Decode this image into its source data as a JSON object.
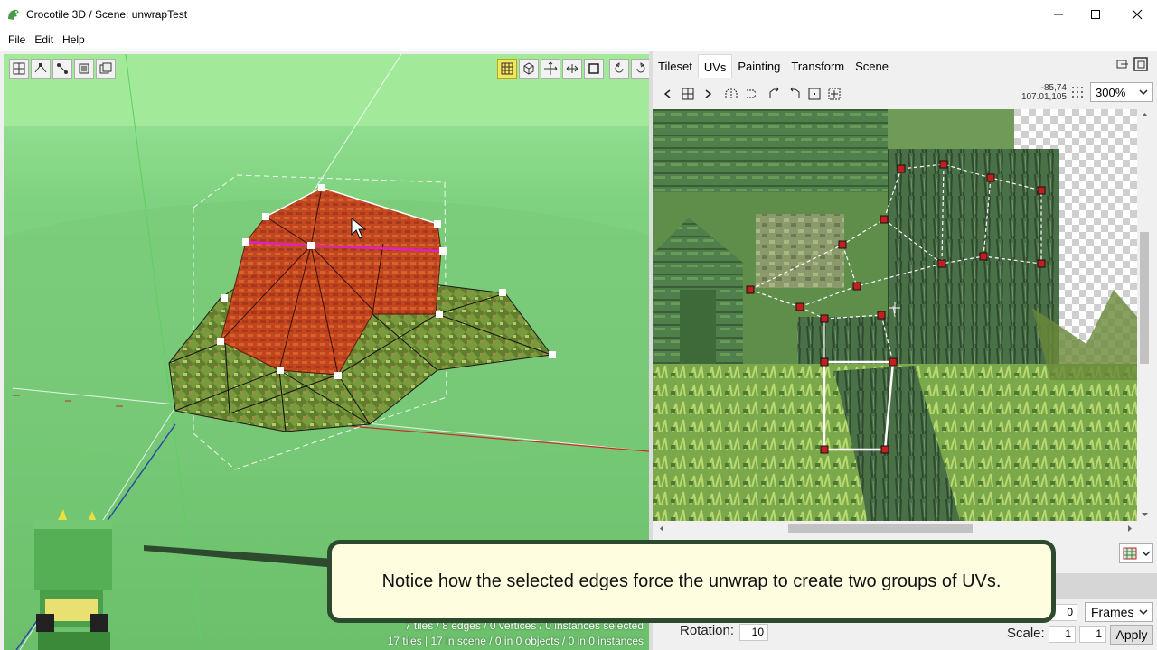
{
  "window": {
    "title": "Crocotile 3D / Scene: unwrapTest",
    "minimize_symbol": "—",
    "maximize_symbol": "☐",
    "close_symbol": "✕"
  },
  "menu": [
    "File",
    "Edit",
    "Help"
  ],
  "viewport": {
    "status_line1": "7 tiles / 8 edges / 0 vertices / 0 instances selected",
    "status_line2": "17 tiles | 17 in scene / 0 in 0 objects / 0 in 0 instances"
  },
  "panel": {
    "tabs": [
      "Tileset",
      "UVs",
      "Painting",
      "Transform",
      "Scene"
    ],
    "active_tab": "UVs",
    "coords_line1": "-85,74",
    "coords_line2": "107.01,105",
    "zoom": "300%",
    "frames_value": "0",
    "frames_label": "Frames",
    "rotation_label": "Rotation:",
    "rotation_value": "10",
    "scale_label": "Scale:",
    "scale_x": "1",
    "scale_y": "1",
    "apply_label": "Apply"
  },
  "callout": {
    "text": "Notice how the selected edges force the unwrap to create two groups of UVs."
  },
  "colors": {
    "viewport_bg": "#8ede8e",
    "selection_edge": "#e020c0",
    "uv_point": "#c41e1e",
    "callout_border": "#2e4a2e"
  }
}
